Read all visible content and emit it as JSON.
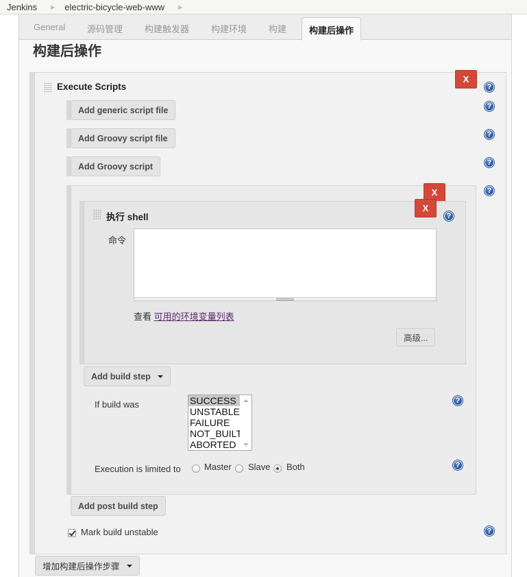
{
  "breadcrumb": {
    "items": [
      "Jenkins",
      "electric-bicycle-web-www"
    ]
  },
  "tabs": [
    {
      "label": "General",
      "active": false
    },
    {
      "label": "源码管理",
      "active": false
    },
    {
      "label": "构建触发器",
      "active": false
    },
    {
      "label": "构建环境",
      "active": false
    },
    {
      "label": "构建",
      "active": false
    },
    {
      "label": "构建后操作",
      "active": true
    }
  ],
  "section_title": "构建后操作",
  "execute_scripts": {
    "title": "Execute Scripts",
    "delete_label": "X",
    "buttons": {
      "add_generic_script_file": "Add generic script file",
      "add_groovy_script_file": "Add Groovy script file",
      "add_groovy_script": "Add Groovy script"
    },
    "nested": {
      "delete_label": "X",
      "shell": {
        "title": "执行 shell",
        "delete_label": "X",
        "command_label": "命令",
        "command_value": "",
        "env_prefix": "查看",
        "env_link": "可用的环境变量列表",
        "advanced_button": "高级..."
      },
      "add_build_step": "Add build step",
      "if_build_was_label": "If build was",
      "build_results": [
        {
          "label": "SUCCESS",
          "selected": true
        },
        {
          "label": "UNSTABLE",
          "selected": false
        },
        {
          "label": "FAILURE",
          "selected": false
        },
        {
          "label": "NOT_BUILT",
          "selected": false
        },
        {
          "label": "ABORTED",
          "selected": false
        }
      ],
      "execution_label": "Execution is limited to",
      "execution_options": [
        {
          "label": "Master",
          "checked": false
        },
        {
          "label": "Slave",
          "checked": false
        },
        {
          "label": "Both",
          "checked": true
        }
      ]
    },
    "add_post_build_step": "Add post build step",
    "mark_build_unstable": {
      "label": "Mark build unstable",
      "checked": true
    }
  },
  "add_post_build_action": "增加构建后操作步骤",
  "icons": {
    "help": "?",
    "drag": "drag-handle",
    "caret": "caret-down"
  },
  "colors": {
    "delete_button": "#d24939",
    "help_icon": "#23509a",
    "link": "#5b2a6e"
  }
}
